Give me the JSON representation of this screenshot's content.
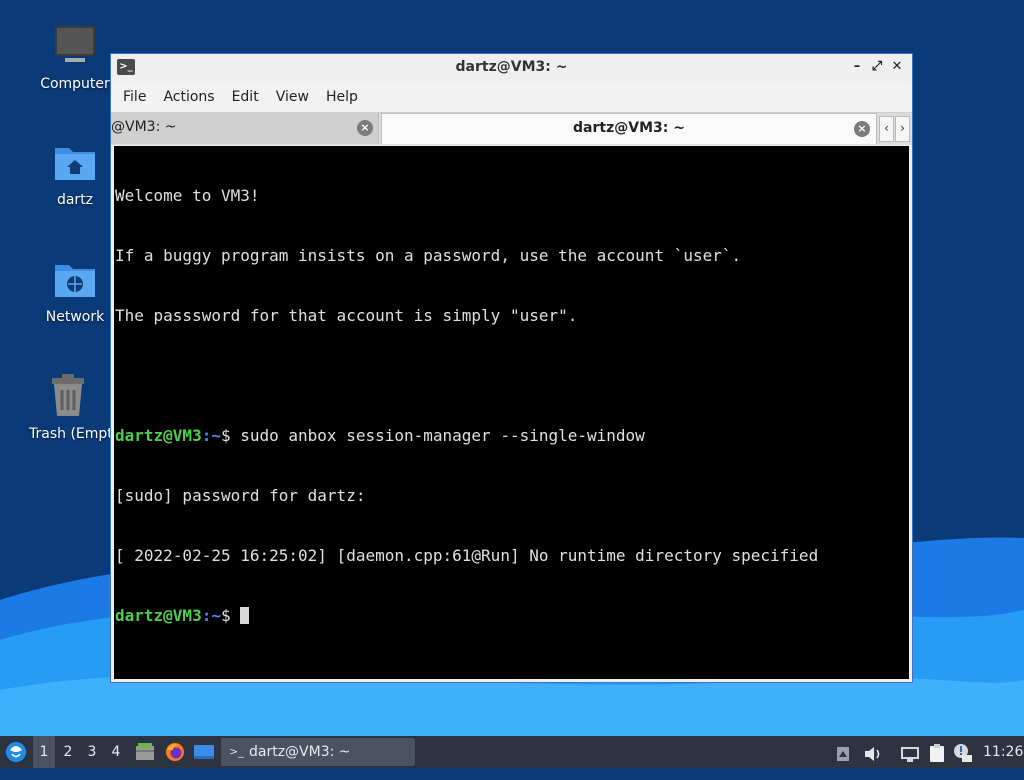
{
  "desktop": {
    "icons": [
      {
        "label": "Computer"
      },
      {
        "label": "dartz"
      },
      {
        "label": "Network"
      },
      {
        "label": "Trash (Empty)"
      }
    ]
  },
  "window": {
    "title": "dartz@VM3: ~",
    "controls": {
      "minimize": "–",
      "maximize": "⤢",
      "close": "✕"
    }
  },
  "menubar": {
    "items": [
      "File",
      "Actions",
      "Edit",
      "View",
      "Help"
    ]
  },
  "tabs": [
    {
      "label": "@VM3: ~",
      "active": false
    },
    {
      "label": "dartz@VM3: ~",
      "active": true
    }
  ],
  "terminal": {
    "lines": [
      "Welcome to VM3!",
      "If a buggy program insists on a password, use the account `user`.",
      "The passsword for that account is simply \"user\".",
      "",
      "sudo anbox session-manager --single-window",
      "[sudo] password for dartz:",
      "[ 2022-02-25 16:25:02] [daemon.cpp:61@Run] No runtime directory specified"
    ],
    "prompt_user": "dartz@VM3",
    "prompt_path": ":~",
    "prompt_symbol": "$ "
  },
  "taskbar": {
    "desktops": [
      "1",
      "2",
      "3",
      "4"
    ],
    "active_desktop": "1",
    "task_label": "dartz@VM3: ~",
    "clock": "11:26"
  },
  "colors": {
    "prompt_user": "#4ccf4a",
    "prompt_path": "#4a8be8",
    "taskbar_bg": "#2d3340",
    "window_border": "#3a72c4"
  }
}
